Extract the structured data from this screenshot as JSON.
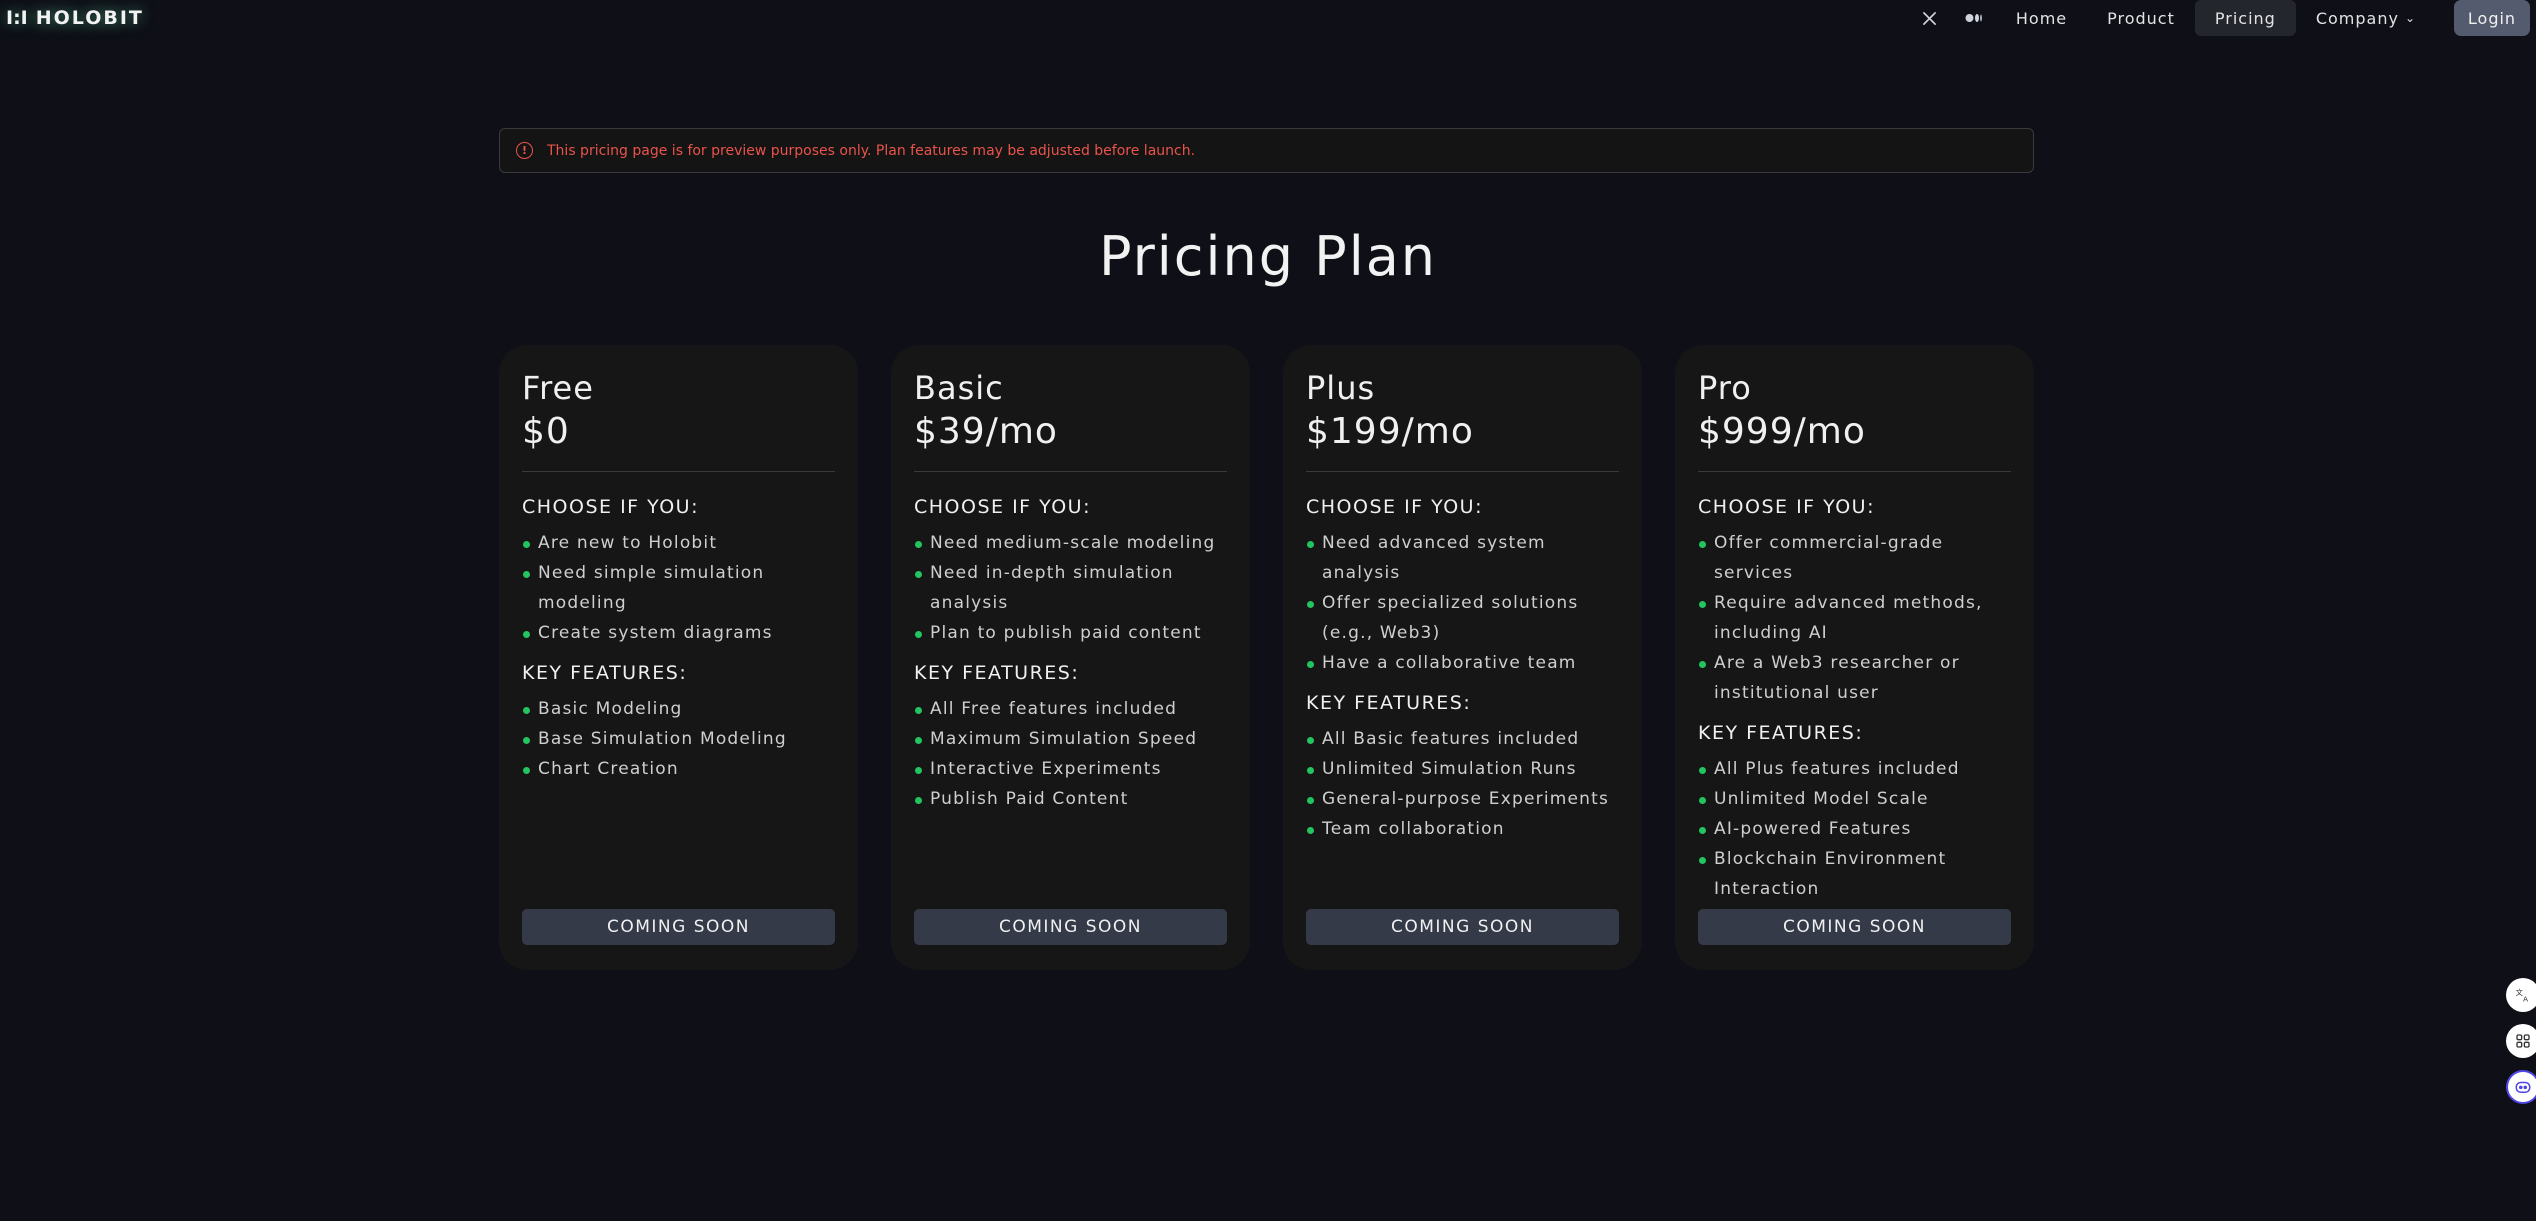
{
  "nav": {
    "logo_mark": "I:I",
    "logo_text": "HOLOBIT",
    "icons": [
      "x-icon",
      "medium-icon"
    ],
    "links": [
      {
        "label": "Home"
      },
      {
        "label": "Product"
      },
      {
        "label": "Pricing",
        "active": true
      },
      {
        "label": "Company"
      }
    ],
    "login_label": "Login"
  },
  "notice": {
    "text": "This pricing page is for preview purposes only. Plan features may be adjusted before launch.",
    "color": "#e9534a"
  },
  "title": "Pricing Plan",
  "choose_heading": "CHOOSE IF YOU:",
  "features_heading": "KEY FEATURES:",
  "cta_label": "COMING SOON",
  "plans": [
    {
      "name": "Free",
      "price": "$0",
      "choose": [
        "Are new to Holobit",
        "Need simple simulation modeling",
        "Create system diagrams"
      ],
      "features": [
        "Basic Modeling",
        "Base Simulation Modeling",
        "Chart Creation"
      ]
    },
    {
      "name": "Basic",
      "price": "$39/mo",
      "choose": [
        "Need medium-scale modeling",
        "Need in-depth simulation analysis",
        "Plan to publish paid content"
      ],
      "features": [
        "All Free features included",
        "Maximum Simulation Speed",
        "Interactive Experiments",
        "Publish Paid Content"
      ]
    },
    {
      "name": "Plus",
      "price": "$199/mo",
      "choose": [
        "Need advanced system analysis",
        "Offer specialized solutions (e.g., Web3)",
        "Have a collaborative team"
      ],
      "features": [
        "All Basic features included",
        "Unlimited Simulation Runs",
        "General-purpose Experiments",
        "Team collaboration"
      ]
    },
    {
      "name": "Pro",
      "price": "$999/mo",
      "choose": [
        "Offer commercial-grade services",
        "Require advanced methods, including AI",
        "Are a Web3 researcher or institutional user"
      ],
      "features": [
        "All Plus features included",
        "Unlimited Model Scale",
        "AI-powered Features",
        "Blockchain Environment Interaction"
      ]
    }
  ],
  "colors": {
    "background": "#0e0f17",
    "card": "#161616",
    "bullet": "#22c55e",
    "cta": "#343a48",
    "login": "#555b6e"
  },
  "floating_icons": [
    "translate-icon",
    "apps-icon",
    "ai-assistant-icon"
  ]
}
